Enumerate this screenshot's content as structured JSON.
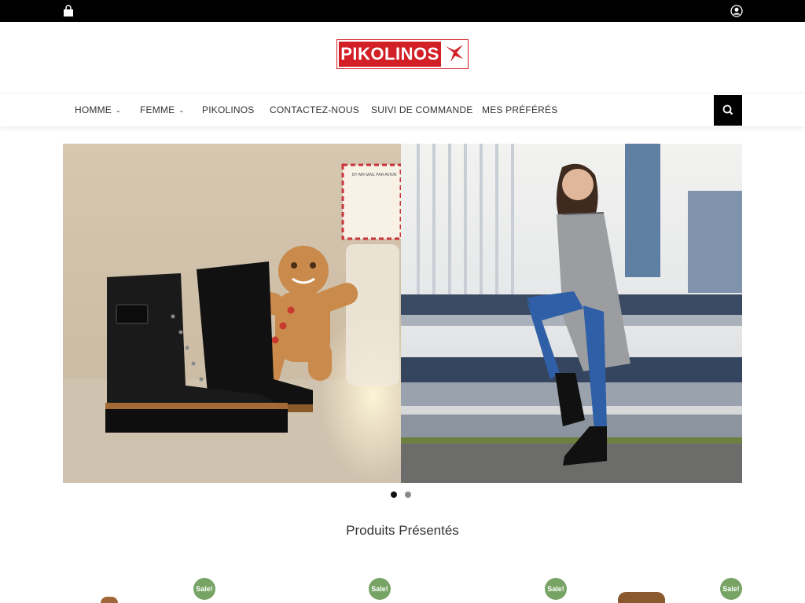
{
  "topbar": {
    "bag_icon": "shopping-bag-icon",
    "user_icon": "user-account-icon"
  },
  "logo": {
    "text": "PIKOLINOS",
    "brand_color": "#d31f26"
  },
  "nav": {
    "items": [
      {
        "label": "HOMME",
        "dropdown": true
      },
      {
        "label": "FEMME",
        "dropdown": true
      },
      {
        "label": "PIKOLINOS",
        "dropdown": false
      },
      {
        "label": "CONTACTEZ-NOUS",
        "dropdown": false
      },
      {
        "label": "SUIVI DE COMMANDE",
        "dropdown": false
      },
      {
        "label": "MES PRÉFÉRÉS",
        "dropdown": false
      }
    ],
    "search_icon": "search-icon"
  },
  "hero": {
    "slides": 2,
    "active_slide": 1,
    "airmail_text": "BY AIR MAIL PAR AVION"
  },
  "featured": {
    "title": "Produits Présentés",
    "badges": [
      "Sale!",
      "Sale!",
      "Sale!",
      "Sale!"
    ],
    "badge_color": "#77a464"
  }
}
